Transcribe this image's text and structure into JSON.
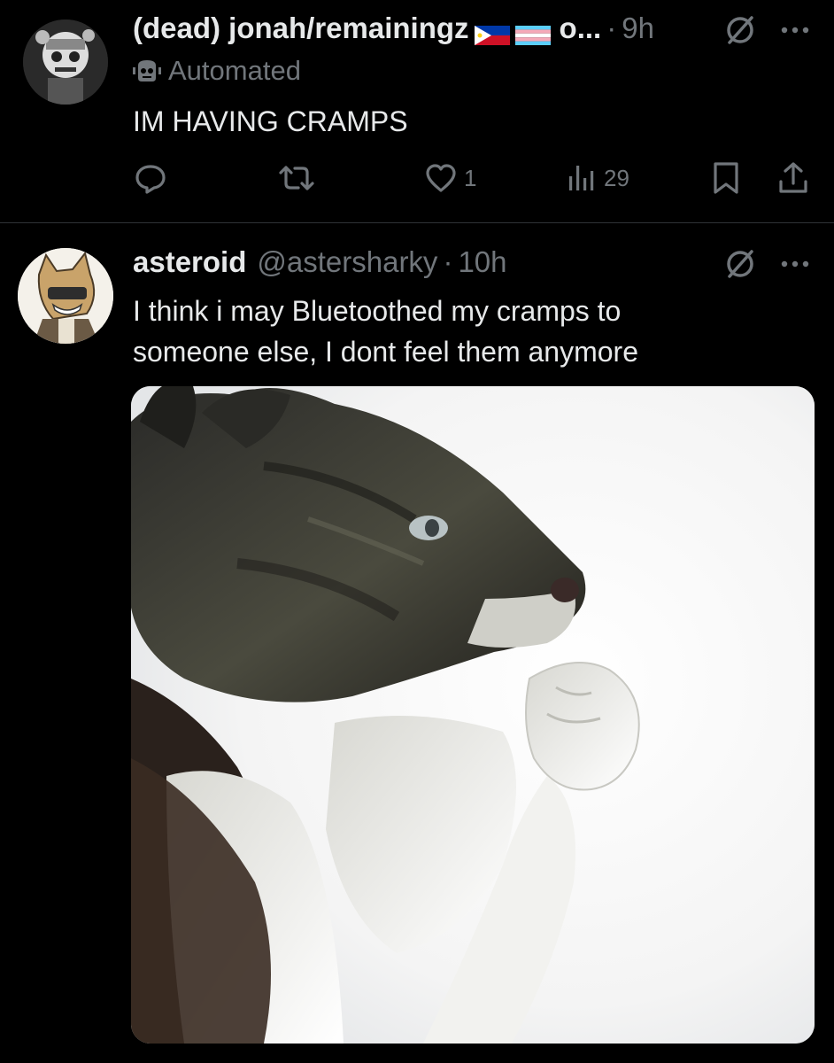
{
  "tweets": [
    {
      "display_name": "(dead) jonah/remainingz",
      "name_trailing": "o...",
      "time": "9h",
      "automated_label": "Automated",
      "text": "IM HAVING CRAMPS",
      "actions": {
        "reply": "",
        "repost": "",
        "like": "1",
        "views": "29"
      }
    },
    {
      "display_name": "asteroid",
      "handle": "@astersharky",
      "time": "10h",
      "text_lines": [
        "I think i may Bluetoothed my cramps to",
        "someone else, I dont feel them anymore"
      ]
    }
  ],
  "separator": "·",
  "icons": {
    "reply": "reply-icon",
    "repost": "repost-icon",
    "like": "heart-icon",
    "views": "views-icon",
    "bookmark": "bookmark-icon",
    "share": "share-icon",
    "grok": "grok-icon",
    "more": "more-icon",
    "automated": "robot-icon"
  },
  "colors": {
    "background": "#000000",
    "text": "#e7e9ea",
    "secondary": "#71767b",
    "divider": "#2f3336"
  }
}
